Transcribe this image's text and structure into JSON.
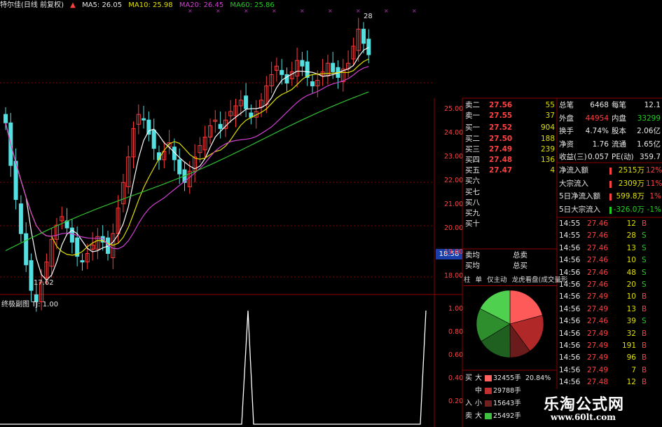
{
  "header": {
    "title": "特尔佳(日线 前复权)",
    "ma5": "MA5: 26.05",
    "ma10": "MA10: 25.98",
    "ma20": "MA20: 26.45",
    "ma60": "MA60: 25.86"
  },
  "chart_labels": {
    "high": "28",
    "low": "17.62",
    "current_price_tag": "18.58",
    "sub_title": "终极副图",
    "sub_tj": "TJ: 1.00"
  },
  "price_axis": [
    "25.00",
    "24.00",
    "23.00",
    "22.00",
    "21.00",
    "20.00",
    "19.00",
    "18.00"
  ],
  "sub_axis": [
    "1.00",
    "0.80",
    "0.60",
    "0.40",
    "0.20"
  ],
  "order_book": [
    {
      "label": "卖二",
      "price": "27.56",
      "vol": "55"
    },
    {
      "label": "卖一",
      "price": "27.55",
      "vol": "37"
    },
    {
      "label": "买一",
      "price": "27.52",
      "vol": "904"
    },
    {
      "label": "买二",
      "price": "27.50",
      "vol": "188"
    },
    {
      "label": "买三",
      "price": "27.49",
      "vol": "239"
    },
    {
      "label": "买四",
      "price": "27.48",
      "vol": "136"
    },
    {
      "label": "买五",
      "price": "27.47",
      "vol": "4"
    },
    {
      "label": "买六",
      "price": "",
      "vol": ""
    },
    {
      "label": "买七",
      "price": "",
      "vol": ""
    },
    {
      "label": "买八",
      "price": "",
      "vol": ""
    },
    {
      "label": "买九",
      "price": "",
      "vol": ""
    },
    {
      "label": "买十",
      "price": "",
      "vol": ""
    }
  ],
  "avg": [
    {
      "label": "卖均",
      "right": "总卖"
    },
    {
      "label": "买均",
      "right": "总买"
    }
  ],
  "tabs": [
    "柱",
    "单",
    "仅主动",
    "龙虎看盘(成交量形"
  ],
  "stats": [
    {
      "k1": "总笔",
      "v1": "6468",
      "k2": "每笔",
      "v2": "12.1"
    },
    {
      "k1": "外盘",
      "v1": "44954",
      "k2": "内盘",
      "v2": "33299"
    },
    {
      "k1": "换手",
      "v1": "4.74%",
      "k2": "股本",
      "v2": "2.06亿"
    },
    {
      "k1": "净资",
      "v1": "1.76",
      "k2": "流通",
      "v2": "1.65亿"
    },
    {
      "k1": "收益(三)",
      "v1": "0.057",
      "k2": "PE(动)",
      "v2": "359.7"
    }
  ],
  "flows": [
    {
      "k": "净流入额",
      "v": "2515万",
      "p": "12%"
    },
    {
      "k": "大宗流入",
      "v": "2309万",
      "p": "11%"
    },
    {
      "k": "5日净流入额",
      "v": "599.8万",
      "p": "1%"
    },
    {
      "k": "5日大宗流入",
      "v": "-326.0万",
      "p": "-1%"
    }
  ],
  "ticks": [
    {
      "t": "14:55",
      "p": "27.46",
      "v": "12",
      "d": "B"
    },
    {
      "t": "14:55",
      "p": "27.46",
      "v": "28",
      "d": "S"
    },
    {
      "t": "14:56",
      "p": "27.46",
      "v": "13",
      "d": "S"
    },
    {
      "t": "14:56",
      "p": "27.46",
      "v": "10",
      "d": "S"
    },
    {
      "t": "14:56",
      "p": "27.46",
      "v": "48",
      "d": "S"
    },
    {
      "t": "14:56",
      "p": "27.46",
      "v": "20",
      "d": "S"
    },
    {
      "t": "14:56",
      "p": "27.49",
      "v": "10",
      "d": "B"
    },
    {
      "t": "14:56",
      "p": "27.49",
      "v": "13",
      "d": "B"
    },
    {
      "t": "14:56",
      "p": "27.46",
      "v": "39",
      "d": "S"
    },
    {
      "t": "14:56",
      "p": "27.49",
      "v": "32",
      "d": "B"
    },
    {
      "t": "14:56",
      "p": "27.49",
      "v": "191",
      "d": "B"
    },
    {
      "t": "14:56",
      "p": "27.49",
      "v": "96",
      "d": "B"
    },
    {
      "t": "14:56",
      "p": "27.49",
      "v": "7",
      "d": "B"
    },
    {
      "t": "14:56",
      "p": "27.48",
      "v": "12",
      "d": "B"
    }
  ],
  "pie_legend": [
    {
      "side": "买",
      "size": "大",
      "vol": "32455手",
      "pct": "20.84%",
      "color": "#ff6060"
    },
    {
      "side": "",
      "size": "中",
      "vol": "29788手",
      "pct": "",
      "color": "#c03030"
    },
    {
      "side": "入",
      "size": "小",
      "vol": "15643手",
      "pct": "",
      "color": "#702020"
    },
    {
      "side": "卖",
      "size": "大",
      "vol": "25492手",
      "pct": "",
      "color": "#40c040"
    }
  ],
  "pie": {
    "values": [
      20.84,
      19.1,
      10.0,
      16.4,
      16.2,
      17.46
    ],
    "colors": [
      "#ff5a5a",
      "#b02828",
      "#6a1c1c",
      "#1f5f1f",
      "#2e8e2e",
      "#4fd04f"
    ]
  },
  "logo": {
    "line1": "乐淘公式网",
    "line2": "www.60lt.com"
  },
  "colors": {
    "up": "#ff3b3b",
    "down": "#54e0e0",
    "ma5": "#ffffff",
    "ma10": "#e0e000",
    "ma20": "#d040d0",
    "ma60": "#30c030",
    "grid": "#8b0000"
  }
}
